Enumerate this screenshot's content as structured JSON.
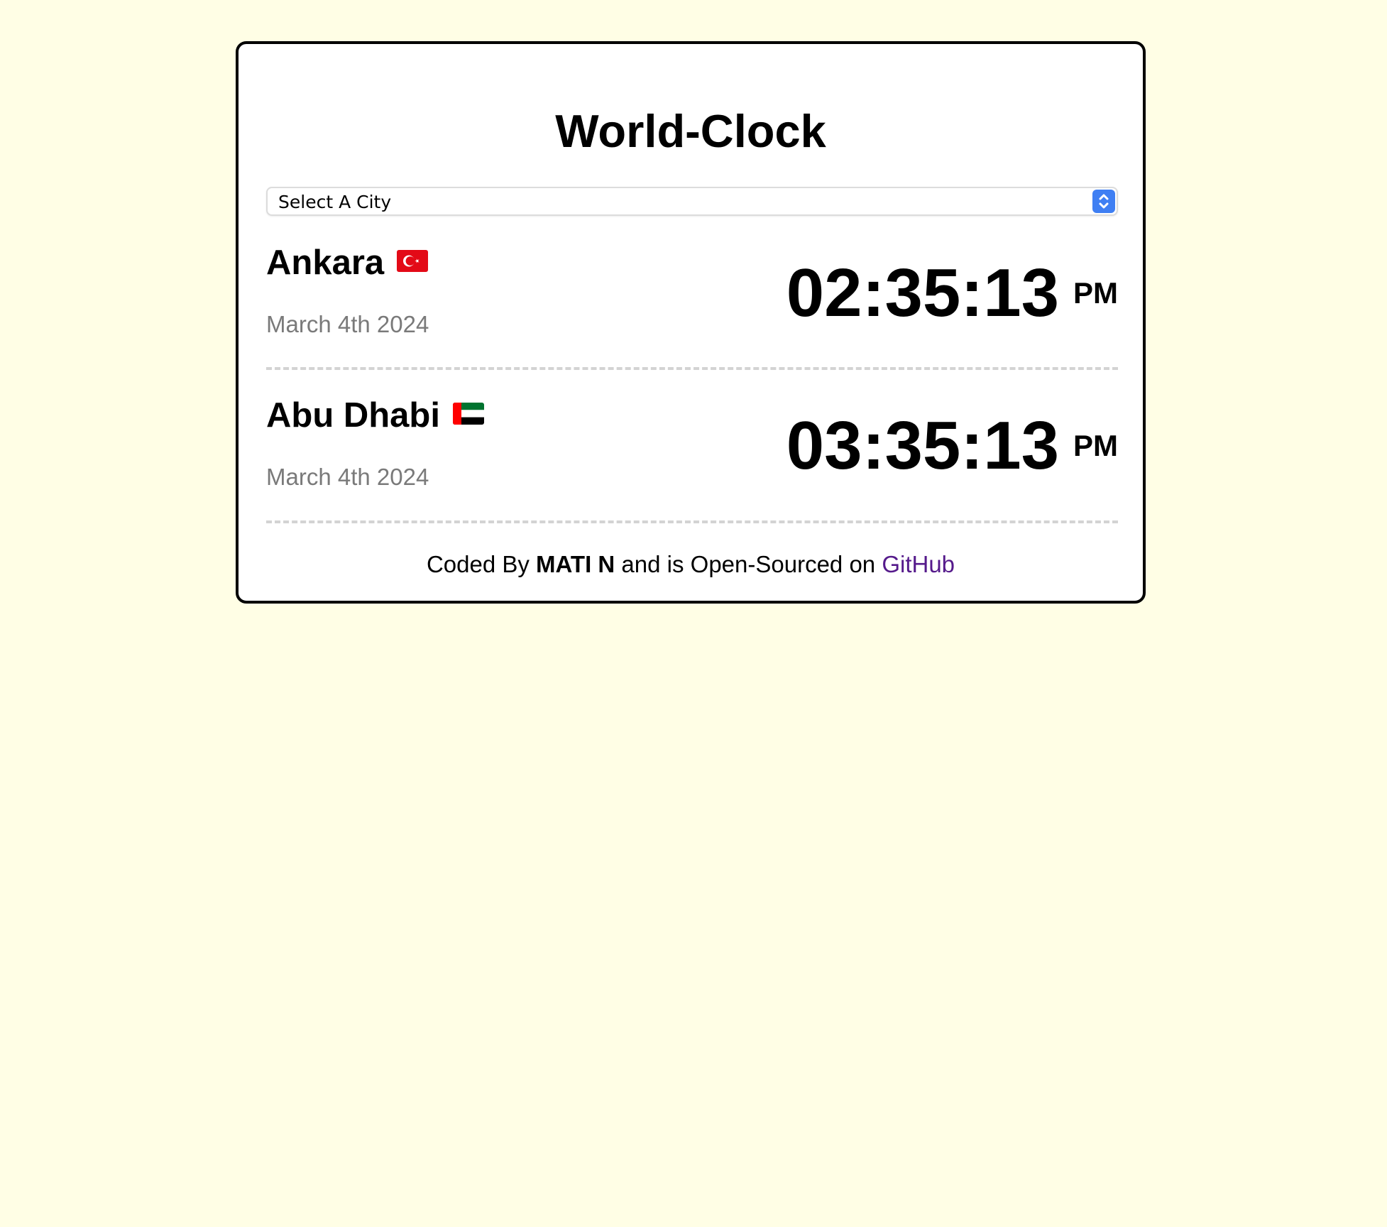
{
  "app": {
    "title": "World-Clock"
  },
  "city_select": {
    "value": "Select A City"
  },
  "cities": [
    {
      "name": "Ankara",
      "flag": "turkey-flag",
      "date": "March 4th 2024",
      "time": "02:35:13",
      "ampm": "PM"
    },
    {
      "name": "Abu Dhabi",
      "flag": "uae-flag",
      "date": "March 4th 2024",
      "time": "03:35:13",
      "ampm": "PM"
    }
  ],
  "footer": {
    "prefix": "Coded By ",
    "author": "MATI N",
    "middle": " and is Open-Sourced on ",
    "link_label": "GitHub"
  },
  "colors": {
    "page_background": "#fffee5",
    "card_background": "#ffffff",
    "card_border": "#000000",
    "date_text": "#7a7a7a",
    "link": "#551a8b",
    "select_accent": "#3f7ff3",
    "divider": "#d3d3d3"
  }
}
